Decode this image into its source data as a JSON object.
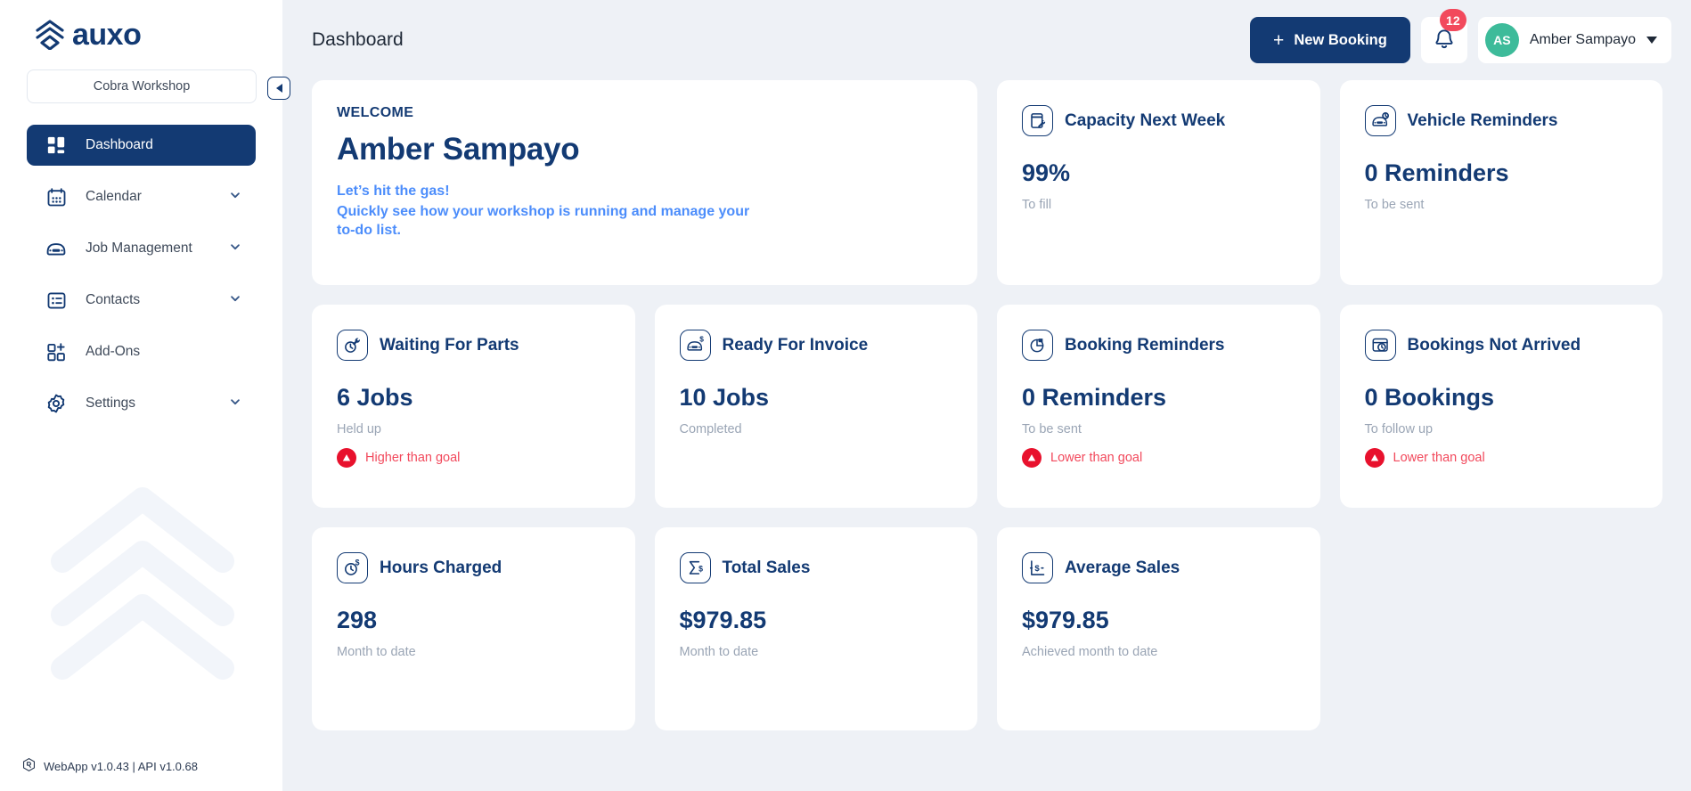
{
  "brand": {
    "name": "auxo",
    "logo_icon": "auxo-chevron-logo"
  },
  "sidebar": {
    "workshop_selector": {
      "value": "Cobra Workshop"
    },
    "collapse_button": {
      "icon": "chevron-left-icon"
    },
    "items": [
      {
        "label": "Dashboard",
        "icon": "dashboard-grid-icon",
        "active": true,
        "expandable": false
      },
      {
        "label": "Calendar",
        "icon": "calendar-icon",
        "active": false,
        "expandable": true
      },
      {
        "label": "Job Management",
        "icon": "car-icon",
        "active": false,
        "expandable": true
      },
      {
        "label": "Contacts",
        "icon": "contacts-card-icon",
        "active": false,
        "expandable": true
      },
      {
        "label": "Add-Ons",
        "icon": "add-ons-icon",
        "active": false,
        "expandable": false
      },
      {
        "label": "Settings",
        "icon": "gear-icon",
        "active": false,
        "expandable": true
      }
    ],
    "footer": {
      "icon": "app-version-icon",
      "text": "WebApp v1.0.43 | API  v1.0.68"
    }
  },
  "header": {
    "title": "Dashboard",
    "new_booking_label": "New Booking",
    "new_booking_icon": "plus-icon",
    "notifications": {
      "icon": "bell-icon",
      "count": "12"
    },
    "user": {
      "initials": "AS",
      "name": "Amber Sampayo",
      "caret_icon": "chevron-down-icon"
    }
  },
  "welcome": {
    "label": "WELCOME",
    "name": "Amber Sampayo",
    "tagline": "Let’s hit the gas!",
    "description": "Quickly see how your workshop is running and manage your to-do list."
  },
  "cards": [
    {
      "title": "Capacity Next Week",
      "icon": "capacity-wrench-icon",
      "value": "99%",
      "sub": "To fill",
      "goal": null
    },
    {
      "title": "Vehicle Reminders",
      "icon": "car-clock-icon",
      "value": "0 Reminders",
      "sub": "To be sent",
      "goal": null
    },
    {
      "title": "Waiting For Parts",
      "icon": "clock-wrench-icon",
      "value": "6 Jobs",
      "sub": "Held up",
      "goal": "Higher than goal"
    },
    {
      "title": "Ready For Invoice",
      "icon": "car-dollar-icon",
      "value": "10 Jobs",
      "sub": "Completed",
      "goal": null
    },
    {
      "title": "Booking Reminders",
      "icon": "booking-reminder-icon",
      "value": "0 Reminders",
      "sub": "To be sent",
      "goal": "Lower than goal"
    },
    {
      "title": "Bookings Not Arrived",
      "icon": "booking-clock-icon",
      "value": "0 Bookings",
      "sub": "To follow up",
      "goal": "Lower than goal"
    },
    {
      "title": "Hours Charged",
      "icon": "clock-dollar-icon",
      "value": "298",
      "sub": "Month to date",
      "goal": null
    },
    {
      "title": "Total Sales",
      "icon": "sigma-dollar-icon",
      "value": "$979.85",
      "sub": "Month to date",
      "goal": null
    },
    {
      "title": "Average Sales",
      "icon": "average-dollar-icon",
      "value": "$979.85",
      "sub": "Achieved month to date",
      "goal": null
    }
  ],
  "colors": {
    "brand_navy": "#133a73",
    "accent_blue": "#4c8dfb",
    "alert_red": "#f2495c",
    "avatar_teal": "#3dbb9a",
    "page_bg": "#eef1f6"
  }
}
